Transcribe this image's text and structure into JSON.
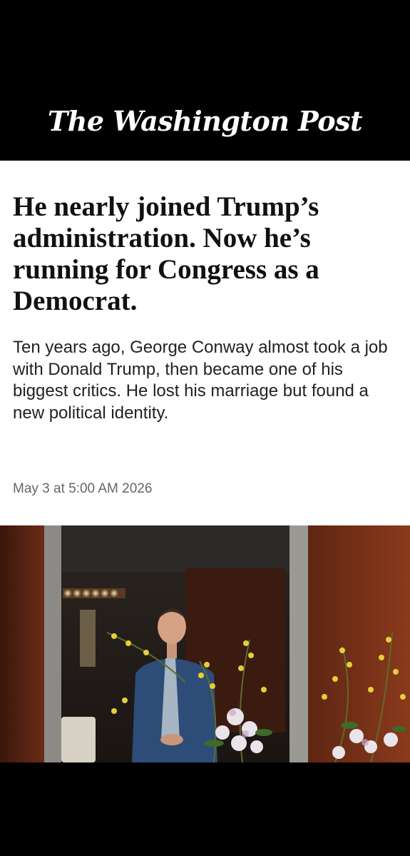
{
  "masthead": {
    "title": "The Washington Post"
  },
  "article": {
    "headline": "He nearly joined Trump’s administration. Now he’s running for Congress as a Democrat.",
    "dek": "Ten years ago, George Conway almost took a job with Donald Trump, then became one of his biggest critics. He lost his marriage but found a new political identity.",
    "timestamp": "May 3 at 5:00 AM 2026"
  },
  "colors": {
    "masthead_bg": "#000000",
    "article_bg": "#ffffff",
    "headline": "#111111",
    "timestamp": "#666666"
  }
}
